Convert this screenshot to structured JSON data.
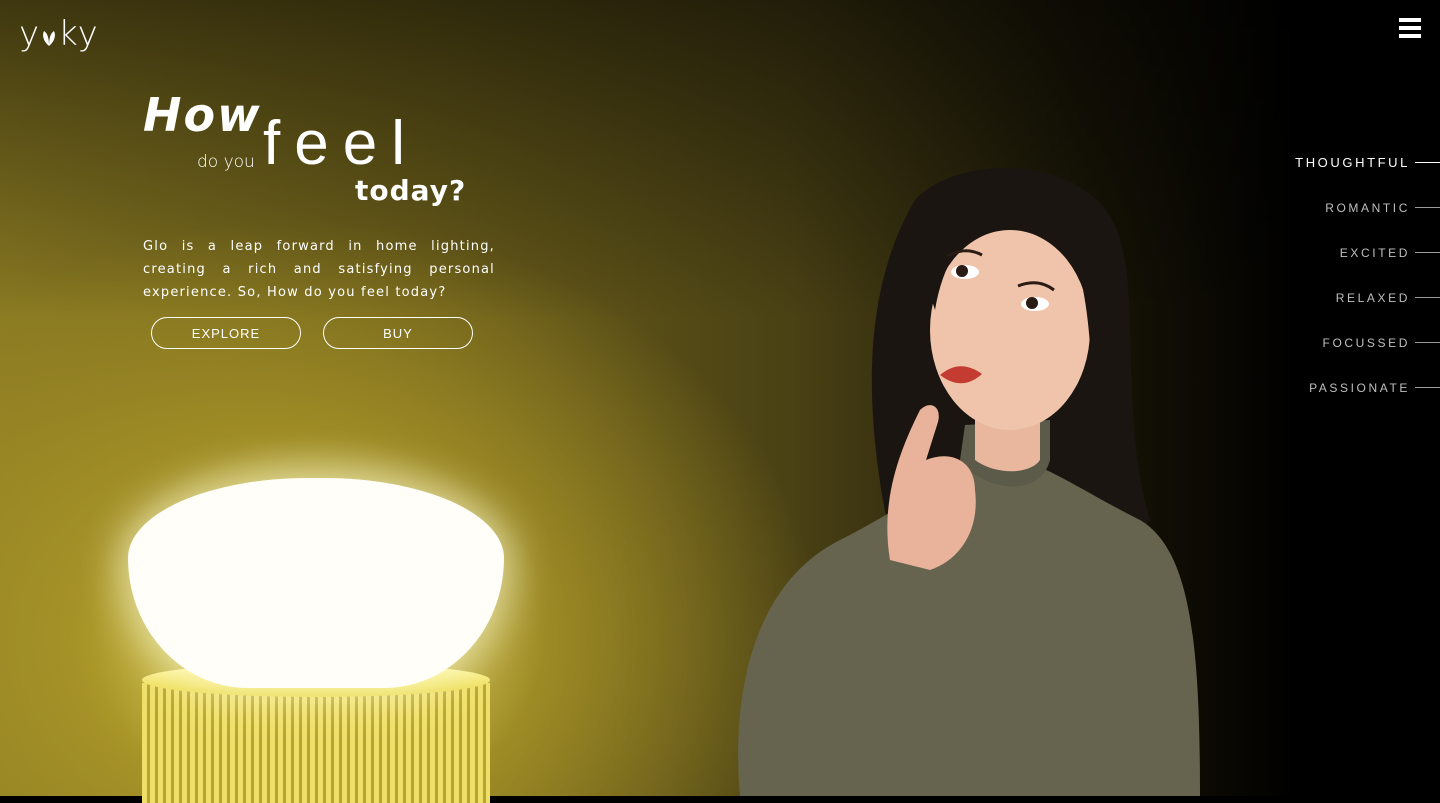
{
  "brand": {
    "logo_text": "yky"
  },
  "headline": {
    "how": "How",
    "do_you": "do you",
    "feel": "feel",
    "today": "today?"
  },
  "intro_text": "Glo is a leap forward in home lighting, creating a rich and satisfying personal experience. So, How do you feel today?",
  "buttons": {
    "explore": "EXPLORE",
    "buy": "BUY"
  },
  "moods": [
    {
      "label": "THOUGHTFUL",
      "active": true
    },
    {
      "label": "ROMANTIC",
      "active": false
    },
    {
      "label": "EXCITED",
      "active": false
    },
    {
      "label": "RELAXED",
      "active": false
    },
    {
      "label": "FOCUSSED",
      "active": false
    },
    {
      "label": "PASSIONATE",
      "active": false
    }
  ],
  "icons": {
    "menu": "hamburger-menu-icon",
    "logo_leaf": "leaf-icon"
  },
  "colors": {
    "accent_yellow": "#e8d640",
    "background": "#000000",
    "text": "#ffffff"
  }
}
